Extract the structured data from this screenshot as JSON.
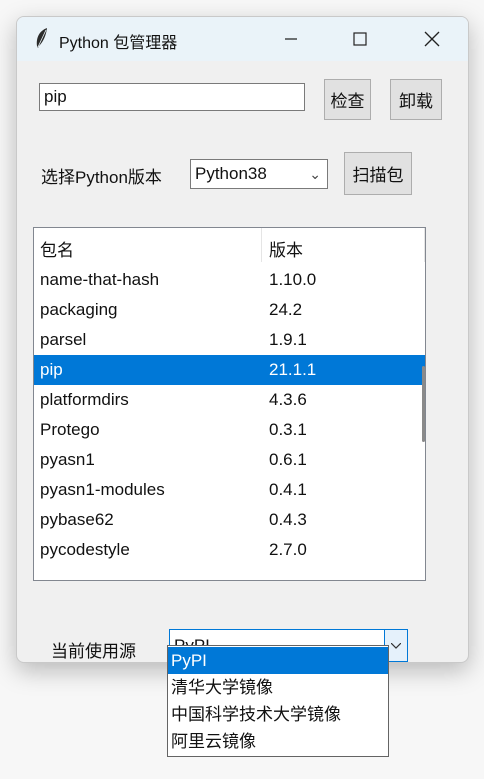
{
  "window": {
    "title": "Python 包管理器"
  },
  "search": {
    "value": "pip",
    "check_label": "检查",
    "uninstall_label": "卸载"
  },
  "version": {
    "label": "选择Python版本",
    "selected": "Python38",
    "scan_label": "扫描包"
  },
  "table": {
    "headers": [
      "包名",
      "版本"
    ],
    "rows": [
      {
        "name": "name-that-hash",
        "version": "1.10.0"
      },
      {
        "name": "packaging",
        "version": "24.2"
      },
      {
        "name": "parsel",
        "version": "1.9.1"
      },
      {
        "name": "pip",
        "version": "21.1.1"
      },
      {
        "name": "platformdirs",
        "version": "4.3.6"
      },
      {
        "name": "Protego",
        "version": "0.3.1"
      },
      {
        "name": "pyasn1",
        "version": "0.6.1"
      },
      {
        "name": "pyasn1-modules",
        "version": "0.4.1"
      },
      {
        "name": "pybase62",
        "version": "0.4.3"
      },
      {
        "name": "pycodestyle",
        "version": "2.7.0"
      }
    ],
    "selected_index": 3
  },
  "source": {
    "label": "当前使用源",
    "selected": "PyPI",
    "options": [
      "PyPI",
      "清华大学镜像",
      "中国科学技术大学镜像",
      "阿里云镜像"
    ],
    "highlighted_index": 0
  },
  "icons": {
    "app": "feather-icon",
    "minimize": "minimize-icon",
    "maximize": "maximize-icon",
    "close": "close-icon",
    "combo_arrow": "chevron-down-icon"
  },
  "colors": {
    "selection": "#0078d7",
    "titlebar": "#eaf3f9"
  }
}
